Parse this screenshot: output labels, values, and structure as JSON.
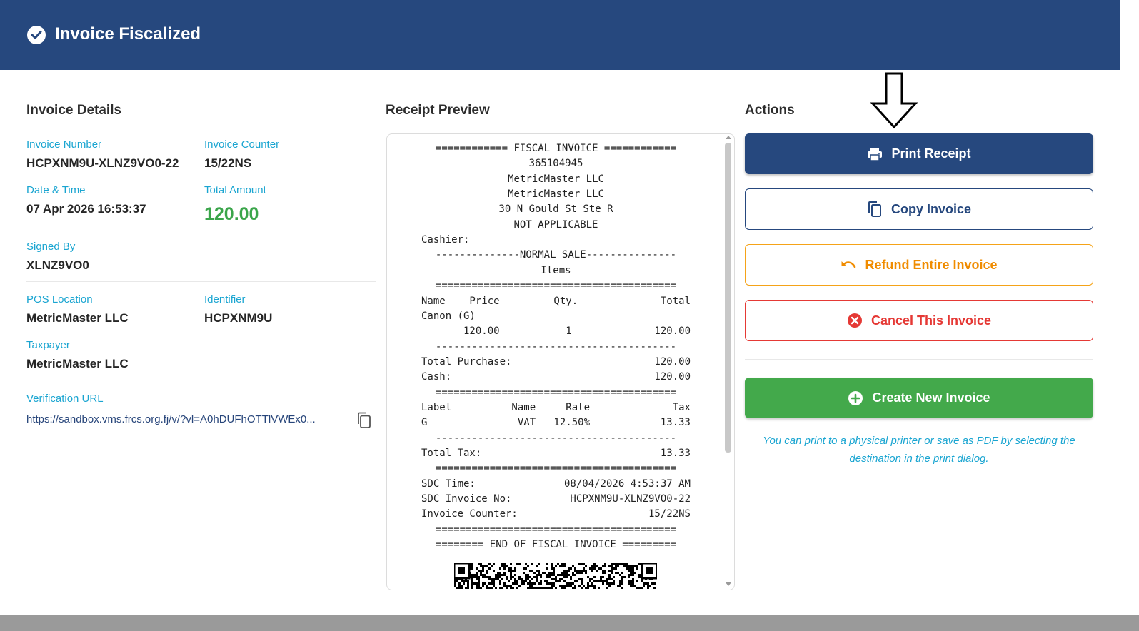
{
  "header": {
    "title": "Invoice Fiscalized"
  },
  "details": {
    "title": "Invoice Details",
    "invoice_number": {
      "label": "Invoice Number",
      "value": "HCPXNM9U-XLNZ9VO0-22"
    },
    "invoice_counter": {
      "label": "Invoice Counter",
      "value": "15/22NS"
    },
    "date_time": {
      "label": "Date & Time",
      "value": "07 Apr 2026 16:53:37"
    },
    "total_amount": {
      "label": "Total Amount",
      "value": "120.00"
    },
    "signed_by": {
      "label": "Signed By",
      "value": "XLNZ9VO0"
    },
    "pos_location": {
      "label": "POS Location",
      "value": "MetricMaster LLC"
    },
    "identifier": {
      "label": "Identifier",
      "value": "HCPXNM9U"
    },
    "taxpayer": {
      "label": "Taxpayer",
      "value": "MetricMaster LLC"
    },
    "verification": {
      "label": "Verification URL",
      "value": "https://sandbox.vms.frcs.org.fj/v/?vl=A0hDUFhOTTlVWEx0..."
    }
  },
  "receipt": {
    "title": "Receipt Preview",
    "lines": [
      {
        "c": "============ FISCAL INVOICE ============"
      },
      {
        "c": "365104945"
      },
      {
        "c": "MetricMaster LLC"
      },
      {
        "c": "MetricMaster LLC"
      },
      {
        "c": "30 N Gould St Ste R"
      },
      {
        "c": "NOT APPLICABLE"
      },
      {
        "l": "Cashier:"
      },
      {
        "c": "--------------NORMAL SALE---------------"
      },
      {
        "c": "Items"
      },
      {
        "c": "========================================"
      },
      {
        "l": "Name    Price         Qty.",
        "r": "Total"
      },
      {
        "l": "Canon (G)"
      },
      {
        "l": "       120.00           1",
        "r": "120.00"
      },
      {
        "c": "----------------------------------------"
      },
      {
        "l": "Total Purchase:",
        "r": "120.00"
      },
      {
        "l": "Cash:",
        "r": "120.00"
      },
      {
        "c": "========================================"
      },
      {
        "l": "Label          Name     Rate",
        "r": "Tax"
      },
      {
        "l": "G               VAT   12.50%",
        "r": "13.33"
      },
      {
        "c": "----------------------------------------"
      },
      {
        "l": "Total Tax:",
        "r": "13.33"
      },
      {
        "c": "========================================"
      },
      {
        "l": "SDC Time:",
        "r": "08/04/2026 4:53:37 AM"
      },
      {
        "l": "SDC Invoice No:",
        "r": "HCPXNM9U-XLNZ9VO0-22"
      },
      {
        "l": "Invoice Counter:",
        "r": "15/22NS"
      },
      {
        "c": "========================================"
      },
      {
        "c": "======== END OF FISCAL INVOICE ========="
      }
    ]
  },
  "actions": {
    "title": "Actions",
    "print": "Print Receipt",
    "copy": "Copy Invoice",
    "refund": "Refund Entire Invoice",
    "cancel": "Cancel This Invoice",
    "create": "Create New Invoice",
    "hint": "You can print to a physical printer or save as PDF by selecting the destination in the print dialog."
  },
  "colors": {
    "header_bg": "#26487e",
    "label": "#1aa5d1",
    "amount": "#3aa54a",
    "refund": "#f08c00",
    "cancel": "#e53935",
    "create": "#43a94b"
  }
}
